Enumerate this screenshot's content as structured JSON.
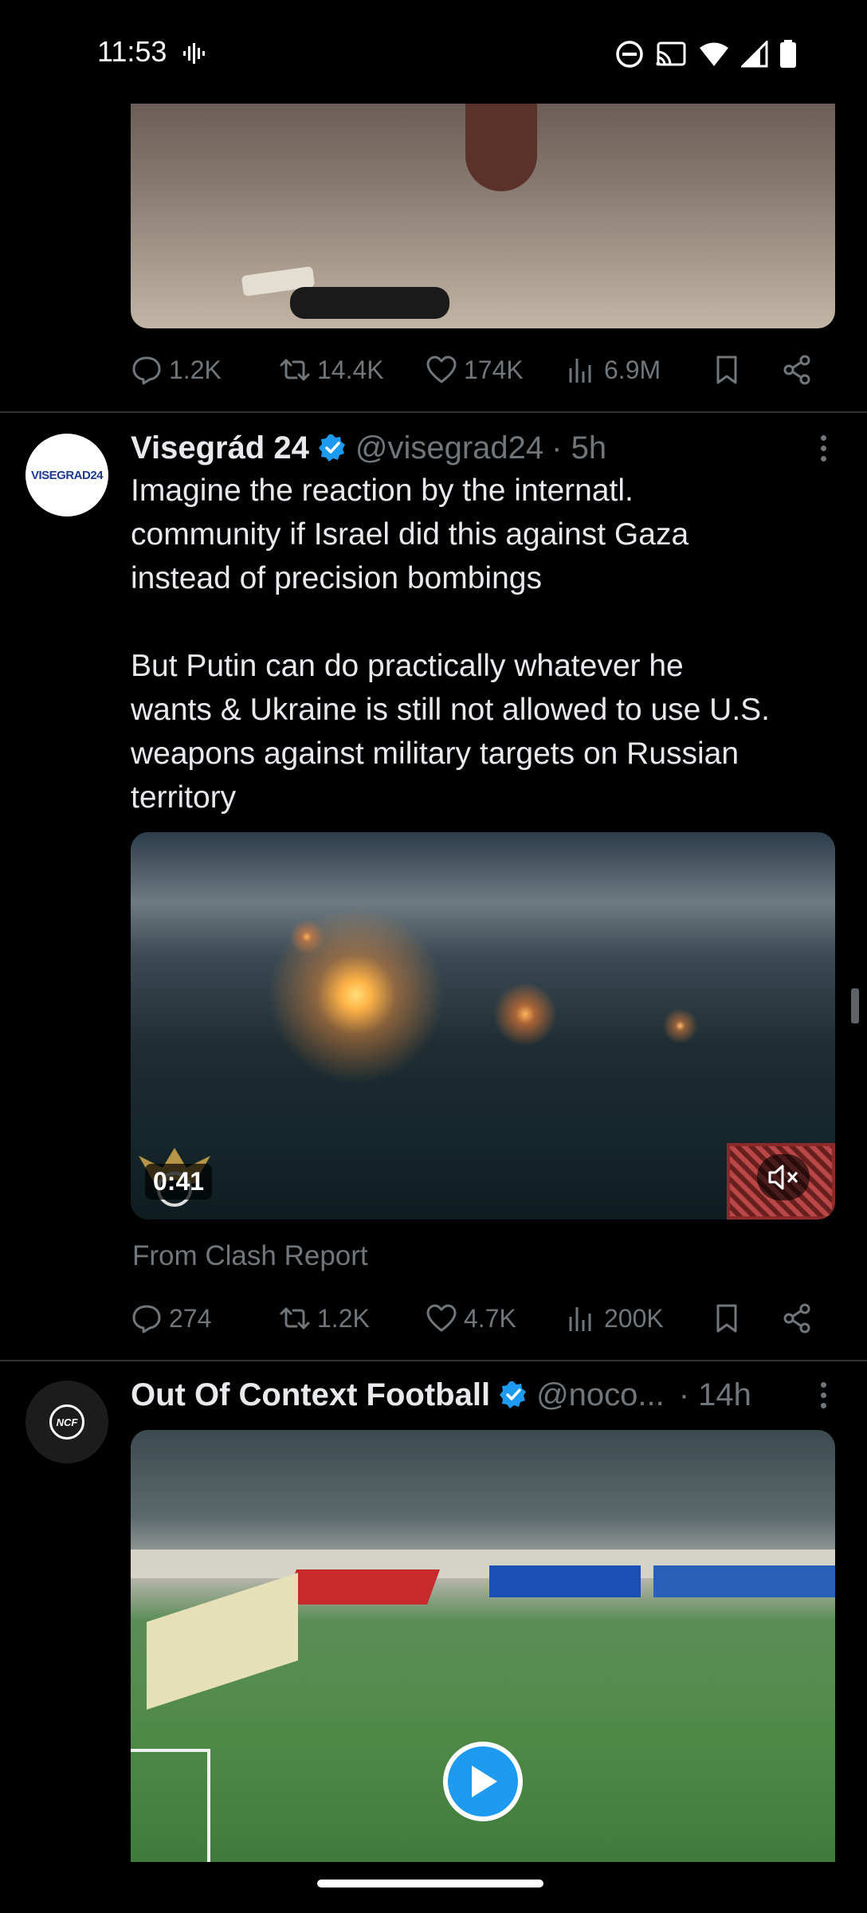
{
  "status_bar": {
    "time": "11:53",
    "icons": [
      "voice-wave-icon",
      "do-not-disturb-icon",
      "cast-icon",
      "wifi-icon",
      "cellular-signal-icon",
      "battery-icon"
    ]
  },
  "top_post": {
    "actions": {
      "replies": "1.2K",
      "reposts": "14.4K",
      "likes": "174K",
      "views": "6.9M"
    }
  },
  "posts": [
    {
      "avatar_text": "VISEGRAD24",
      "display_name": "Visegrád 24",
      "handle": "@visegrad24",
      "time": "· 5h",
      "text_lines": [
        "Imagine the reaction by the internatl.",
        "community if Israel did this against Gaza",
        "instead of precision bombings",
        "",
        "But Putin can do practically whatever he",
        "wants & Ukraine is still not allowed to use U.S.",
        "weapons against military targets on Russian",
        "territory"
      ],
      "video_duration": "0:41",
      "source": "From Clash Report",
      "actions": {
        "replies": "274",
        "reposts": "1.2K",
        "likes": "4.7K",
        "views": "200K"
      }
    },
    {
      "avatar_text": "NCF",
      "display_name": "Out Of Context Football",
      "handle": "@noco...",
      "time": "· 14h"
    }
  ],
  "colors": {
    "background": "#000000",
    "text_primary": "#e7e9ea",
    "text_secondary": "#71767b",
    "verified_blue": "#1d9bf0",
    "divider": "#2f3336"
  }
}
